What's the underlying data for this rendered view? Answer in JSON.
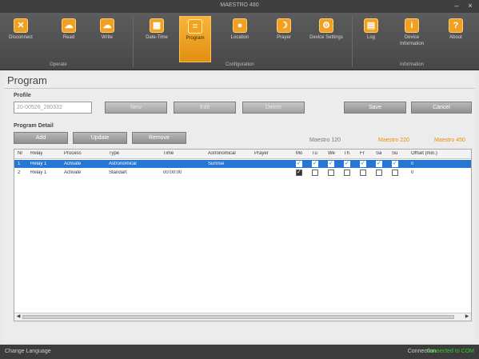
{
  "window": {
    "title": "MAESTRO 480",
    "minimize": "–",
    "close": "×"
  },
  "ribbon": {
    "buttons": [
      {
        "label": "Disconnect",
        "icon": "x-icon",
        "glyph": "✕"
      },
      {
        "label": "Read",
        "icon": "cloud-download-icon",
        "glyph": "☁"
      },
      {
        "label": "Write",
        "icon": "cloud-upload-icon",
        "glyph": "☁"
      },
      {
        "label": "Date-Time",
        "icon": "calendar-icon",
        "glyph": "▦"
      },
      {
        "label": "Program",
        "icon": "program-icon",
        "glyph": "≡"
      },
      {
        "label": "Location",
        "icon": "location-icon",
        "glyph": "●"
      },
      {
        "label": "Prayer",
        "icon": "prayer-icon",
        "glyph": "☽"
      },
      {
        "label": "Device Settings",
        "icon": "gear-icon",
        "glyph": "⚙"
      },
      {
        "label": "Log",
        "icon": "log-icon",
        "glyph": "▤"
      },
      {
        "label": "Device Information",
        "icon": "info-icon",
        "glyph": "i"
      },
      {
        "label": "About",
        "icon": "about-icon",
        "glyph": "?"
      }
    ],
    "groups": [
      "Operate",
      "Configuration",
      "Information"
    ]
  },
  "page": {
    "title": "Program"
  },
  "profile": {
    "label": "Profile",
    "value": "20-00526_280332",
    "new_label": "New",
    "edit_label": "Edit",
    "delete_label": "Delete",
    "save_label": "Save",
    "cancel_label": "Cancel"
  },
  "detail": {
    "label": "Program Detail",
    "add_label": "Add",
    "update_label": "Update",
    "remove_label": "Remove",
    "models": [
      "Maestro 120",
      "Maestro 220",
      "Maestro 450"
    ]
  },
  "table": {
    "headers": [
      "Nr",
      "Relay",
      "Process",
      "Type",
      "Time",
      "Astronomical",
      "Prayer",
      "Mo",
      "Tu",
      "We",
      "Th",
      "Fr",
      "Sa",
      "Su",
      "Offset (min.)"
    ],
    "rows": [
      {
        "nr": "1",
        "relay": "Relay 1",
        "process": "Activate",
        "type": "Astronomical",
        "time": "",
        "astro": "Sunrise",
        "prayer": "",
        "days": [
          true,
          true,
          true,
          true,
          true,
          true,
          true
        ],
        "offset": "0",
        "selected": true
      },
      {
        "nr": "2",
        "relay": "Relay 1",
        "process": "Activate",
        "type": "Standart",
        "time": "00:00:00",
        "astro": "",
        "prayer": "",
        "days": [
          true,
          false,
          false,
          false,
          false,
          false,
          false
        ],
        "offset": "0",
        "selected": false
      }
    ]
  },
  "status": {
    "change_language": "Change Language",
    "connection_label": "Connection :",
    "connection_value": "Connected to COM"
  },
  "colors": {
    "accent": "#f0a023",
    "selection": "#2676d3",
    "model_highlight": "#f08c00",
    "connected": "#2ad12a"
  }
}
